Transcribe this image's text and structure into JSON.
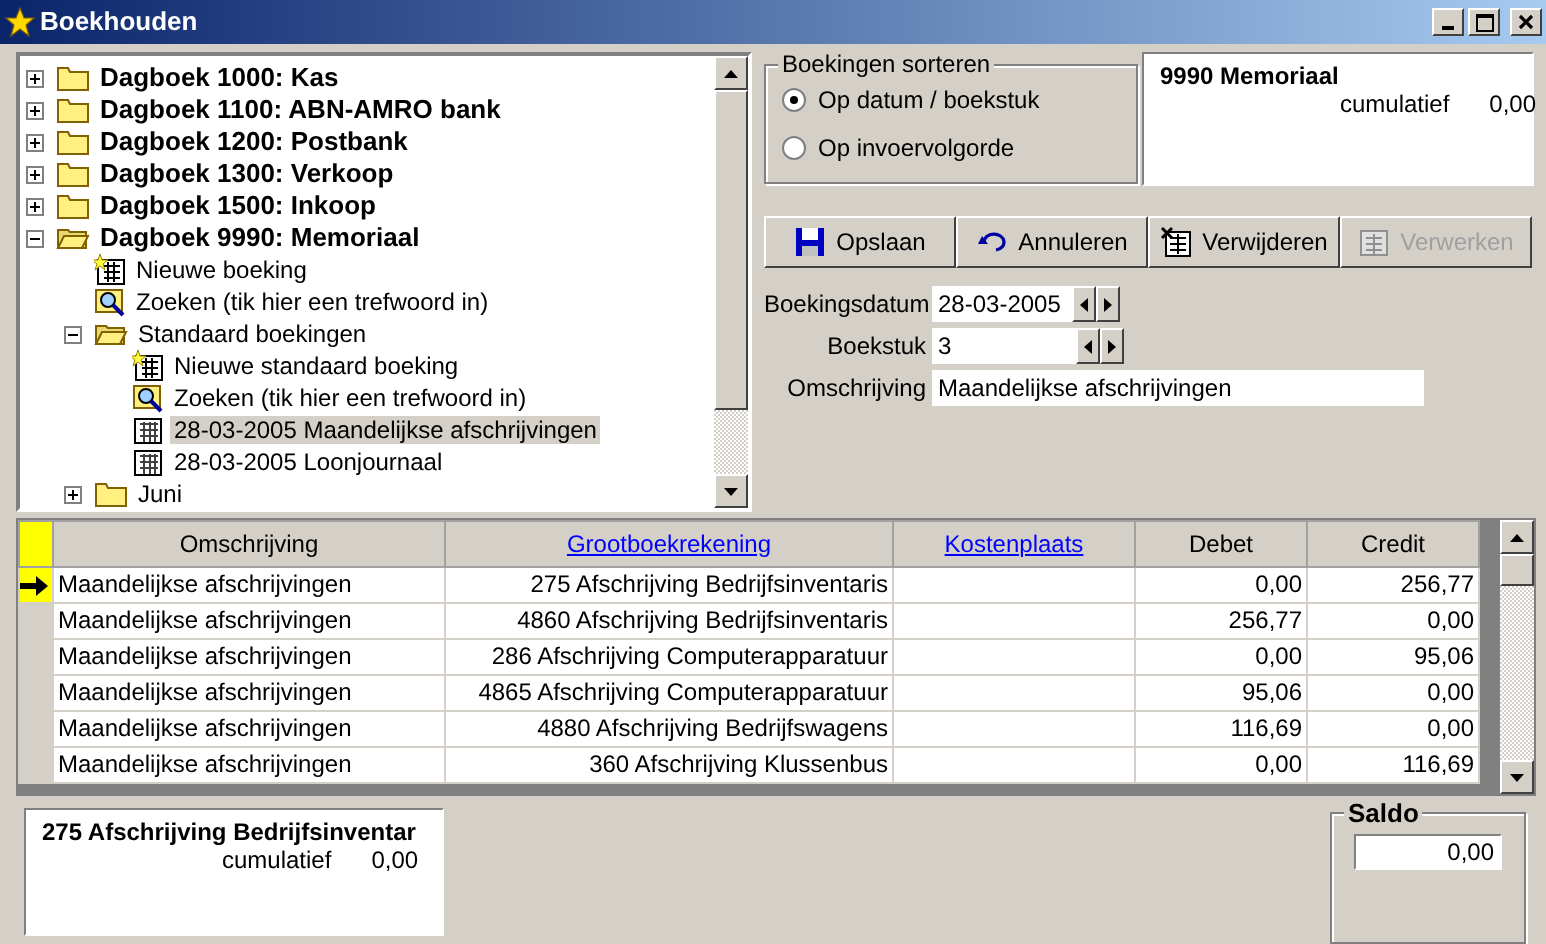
{
  "window": {
    "title": "Boekhouden"
  },
  "tree": [
    {
      "label": "Dagboek 1000: Kas",
      "kind": "folder",
      "expanded": false,
      "selected": false
    },
    {
      "label": "Dagboek 1100: ABN-AMRO bank",
      "kind": "folder",
      "expanded": false,
      "selected": false
    },
    {
      "label": "Dagboek 1200: Postbank",
      "kind": "folder",
      "expanded": false,
      "selected": false
    },
    {
      "label": "Dagboek 1300: Verkoop",
      "kind": "folder",
      "expanded": false,
      "selected": false
    },
    {
      "label": "Dagboek 1500: Inkoop",
      "kind": "folder",
      "expanded": false,
      "selected": false
    },
    {
      "label": "Dagboek 9990: Memoriaal",
      "kind": "folder",
      "expanded": true,
      "selected": false,
      "children": [
        {
          "label": "Nieuwe boeking",
          "kind": "new",
          "selected": false
        },
        {
          "label": "Zoeken (tik hier een trefwoord in)",
          "kind": "search",
          "selected": false
        },
        {
          "label": "Standaard boekingen",
          "kind": "folder",
          "expanded": true,
          "selected": false,
          "children": [
            {
              "label": "Nieuwe standaard boeking",
              "kind": "new",
              "selected": false
            },
            {
              "label": "Zoeken (tik hier een trefwoord in)",
              "kind": "search",
              "selected": false
            },
            {
              "label": "28-03-2005 Maandelijkse afschrijvingen",
              "kind": "entry",
              "selected": true
            },
            {
              "label": "28-03-2005 Loonjournaal",
              "kind": "entry",
              "selected": false
            }
          ]
        },
        {
          "label": "Juni",
          "kind": "folder",
          "expanded": false,
          "selected": false
        }
      ]
    }
  ],
  "sort": {
    "title": "Boekingen sorteren",
    "options": [
      {
        "label": "Op datum / boekstuk",
        "selected": true
      },
      {
        "label": "Op invoervolgorde",
        "selected": false
      }
    ]
  },
  "journal_summary": {
    "title": "9990 Memoriaal",
    "label": "cumulatief",
    "value": "0,00"
  },
  "toolbar": [
    {
      "label": "Opslaan",
      "kind": "save",
      "disabled": false
    },
    {
      "label": "Annuleren",
      "kind": "undo",
      "disabled": false
    },
    {
      "label": "Verwijderen",
      "kind": "delete",
      "disabled": false
    },
    {
      "label": "Verwerken",
      "kind": "process",
      "disabled": true
    }
  ],
  "form": [
    {
      "label": "Boekingsdatum",
      "value": "28-03-2005",
      "kind": "spinner"
    },
    {
      "label": "Boekstuk",
      "value": "3",
      "kind": "spinner"
    },
    {
      "label": "Omschrijving",
      "value": "Maandelijkse afschrijvingen",
      "kind": "text"
    }
  ],
  "grid": {
    "columns": [
      {
        "label": "Omschrijving",
        "link": false
      },
      {
        "label": "Grootboekrekening",
        "link": true
      },
      {
        "label": "Kostenplaats",
        "link": true
      },
      {
        "label": "Debet",
        "link": false
      },
      {
        "label": "Credit",
        "link": false
      }
    ],
    "rows": [
      {
        "selected": true,
        "cells": [
          "Maandelijkse afschrijvingen",
          "275 Afschrijving Bedrijfsinventaris",
          "",
          "0,00",
          "256,77"
        ]
      },
      {
        "selected": false,
        "cells": [
          "Maandelijkse afschrijvingen",
          "4860 Afschrijving Bedrijfsinventaris",
          "",
          "256,77",
          "0,00"
        ]
      },
      {
        "selected": false,
        "cells": [
          "Maandelijkse afschrijvingen",
          "286 Afschrijving Computerapparatuur",
          "",
          "0,00",
          "95,06"
        ]
      },
      {
        "selected": false,
        "cells": [
          "Maandelijkse afschrijvingen",
          "4865 Afschrijving Computerapparatuur",
          "",
          "95,06",
          "0,00"
        ]
      },
      {
        "selected": false,
        "cells": [
          "Maandelijkse afschrijvingen",
          "4880 Afschrijving Bedrijfswagens",
          "",
          "116,69",
          "0,00"
        ]
      },
      {
        "selected": false,
        "cells": [
          "Maandelijkse afschrijvingen",
          "360 Afschrijving Klussenbus",
          "",
          "0,00",
          "116,69"
        ]
      }
    ]
  },
  "account_summary": {
    "title": "275 Afschrijving Bedrijfsinventar",
    "label": "cumulatief",
    "value": "0,00"
  },
  "saldo": {
    "title": "Saldo",
    "value": "0,00"
  }
}
